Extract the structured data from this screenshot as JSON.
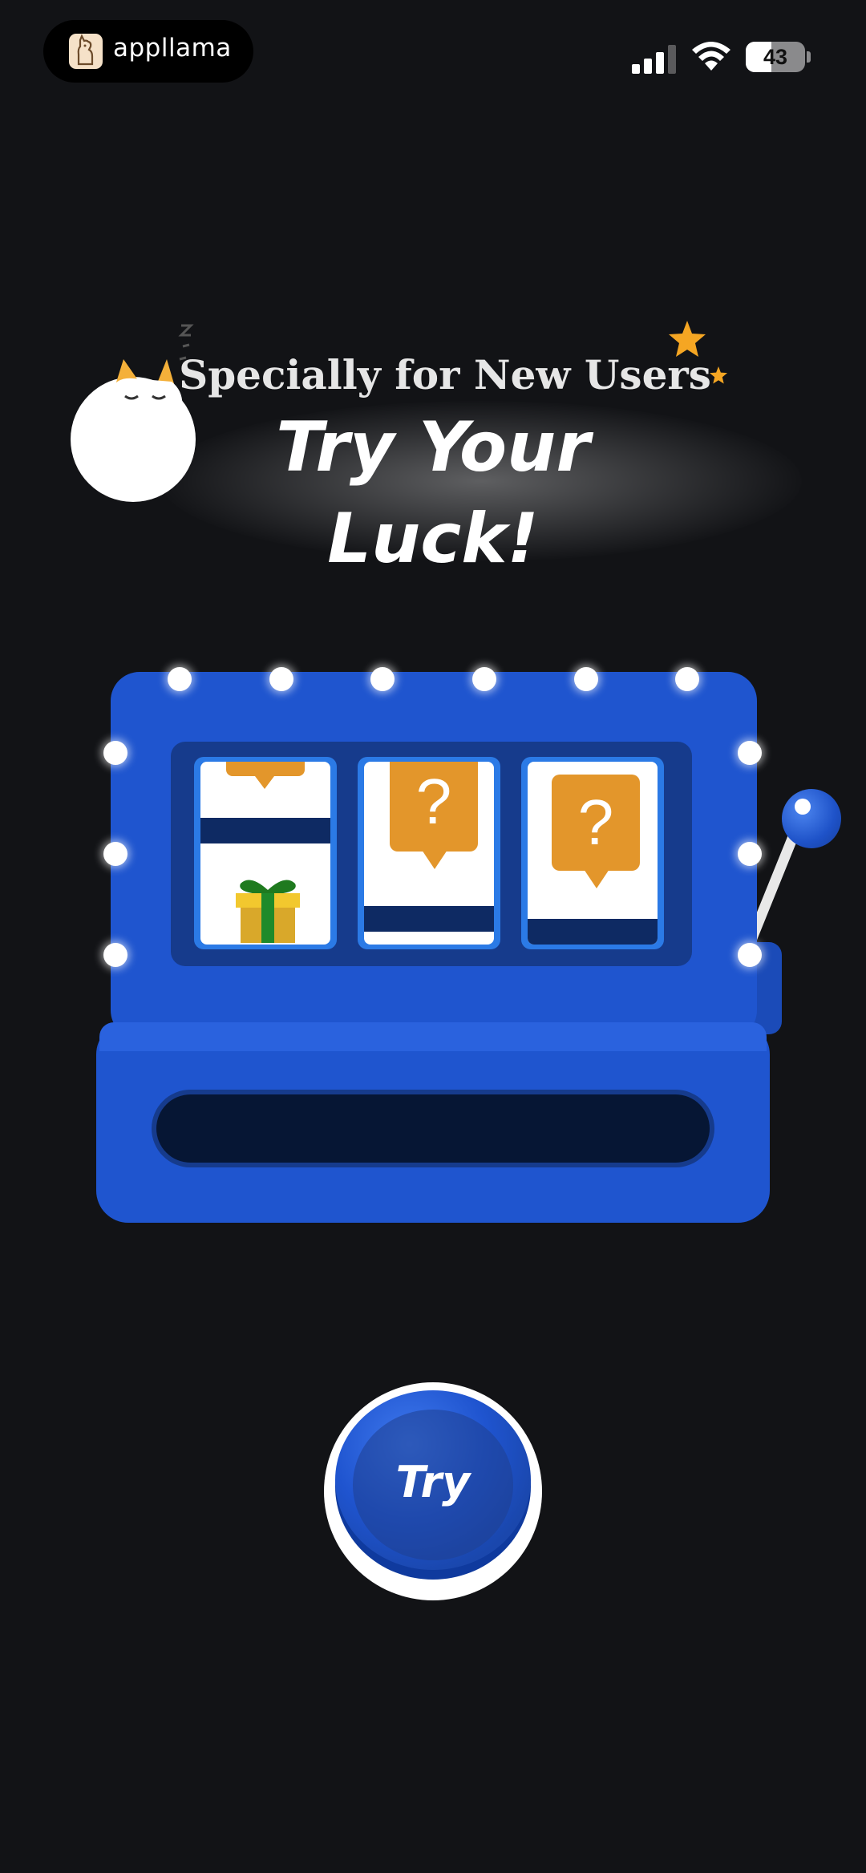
{
  "status_bar": {
    "app_name": "appllama",
    "battery_level": "43",
    "battery_fraction": 0.43
  },
  "header": {
    "subtitle": "Specially for New Users",
    "title_line1": "Try Your",
    "title_line2": "Luck!"
  },
  "slot_machine": {
    "reels": [
      {
        "symbol": "gift-icon"
      },
      {
        "symbol": "question-icon",
        "text": "?"
      },
      {
        "symbol": "question-icon",
        "text": "?"
      }
    ],
    "lever": "lever-handle"
  },
  "try_button": {
    "label": "Try"
  },
  "colors": {
    "background": "#121316",
    "machine_blue": "#1f55cf",
    "accent_orange": "#e3962b",
    "star_yellow": "#f5a623"
  }
}
